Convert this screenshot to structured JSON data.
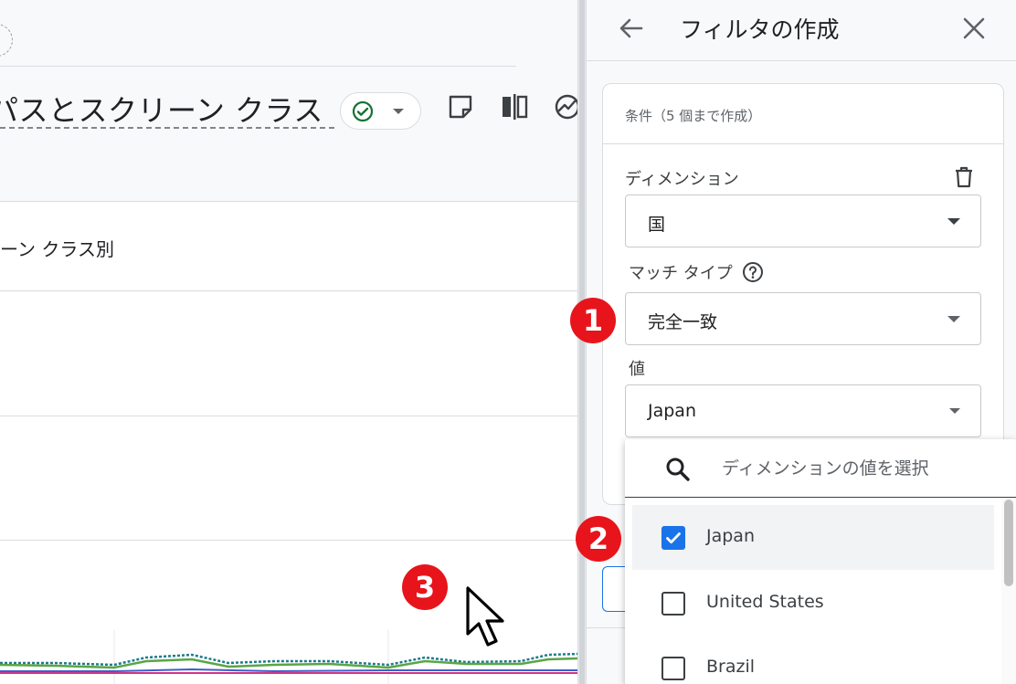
{
  "report": {
    "title": "パスとスクリーン クラス",
    "card_title": "ーン クラス別"
  },
  "filter_panel": {
    "title": "フィルタの作成",
    "conditions_label": "条件（5 個まで作成）",
    "dimension": {
      "label": "ディメンション",
      "value": "国"
    },
    "match_type": {
      "label": "マッチ タイプ",
      "value": "完全一致"
    },
    "value_field": {
      "label": "値",
      "value": "Japan"
    }
  },
  "dropdown": {
    "search_placeholder": "ディメンションの値を選択",
    "options": [
      {
        "label": "Japan",
        "checked": true
      },
      {
        "label": "United States",
        "checked": false
      },
      {
        "label": "Brazil",
        "checked": false
      }
    ]
  },
  "markers": [
    "1",
    "2",
    "3"
  ],
  "colors": {
    "accent": "#1a73e8",
    "marker": "#e8141b",
    "ok_green": "#137333",
    "chart_green": "#5aa546",
    "chart_blue": "#3a5fcd",
    "chart_pink": "#d63384",
    "chart_teal": "#1e7b8c"
  },
  "icons": [
    "status-check-icon",
    "note-icon",
    "compare-icon",
    "insights-icon",
    "back-arrow-icon",
    "close-icon",
    "trash-icon",
    "help-icon",
    "search-icon",
    "check-icon",
    "cursor-icon"
  ]
}
